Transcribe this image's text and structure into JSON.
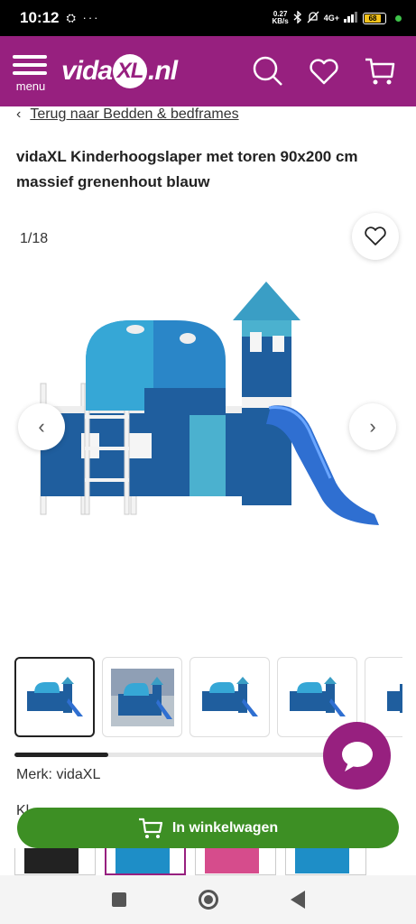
{
  "status": {
    "time": "10:12",
    "left_icons": "⛭ ···",
    "speed_value": "0.27",
    "speed_unit": "KB/s",
    "network": "4G+",
    "battery": "68"
  },
  "header": {
    "menu_label": "menu",
    "logo_left": "vida",
    "logo_xl": "XL",
    "logo_right": ".nl",
    "icons": [
      "search-icon",
      "heart-icon",
      "cart-icon"
    ],
    "brand_color": "#97207f"
  },
  "breadcrumb": {
    "chevron": "‹",
    "link": "Terug naar Bedden & bedframes"
  },
  "product": {
    "title": "vidaXL Kinderhoogslaper met toren 90x200 cm massief grenenhout blauw",
    "image_counter": "1/18",
    "brand_line": "Merk: vidaXL",
    "partial_line": "Kl"
  },
  "gallery": {
    "thumbnail_count": 5,
    "active_index": 0,
    "scroll_progress": 0.3
  },
  "cart_button": {
    "label": "In winkelwagen",
    "color": "#3d8f24"
  },
  "variants": {
    "count": 4,
    "colors": [
      "#222222",
      "#1e8ec7",
      "#d64c8c",
      "#1e8ec7"
    ]
  }
}
